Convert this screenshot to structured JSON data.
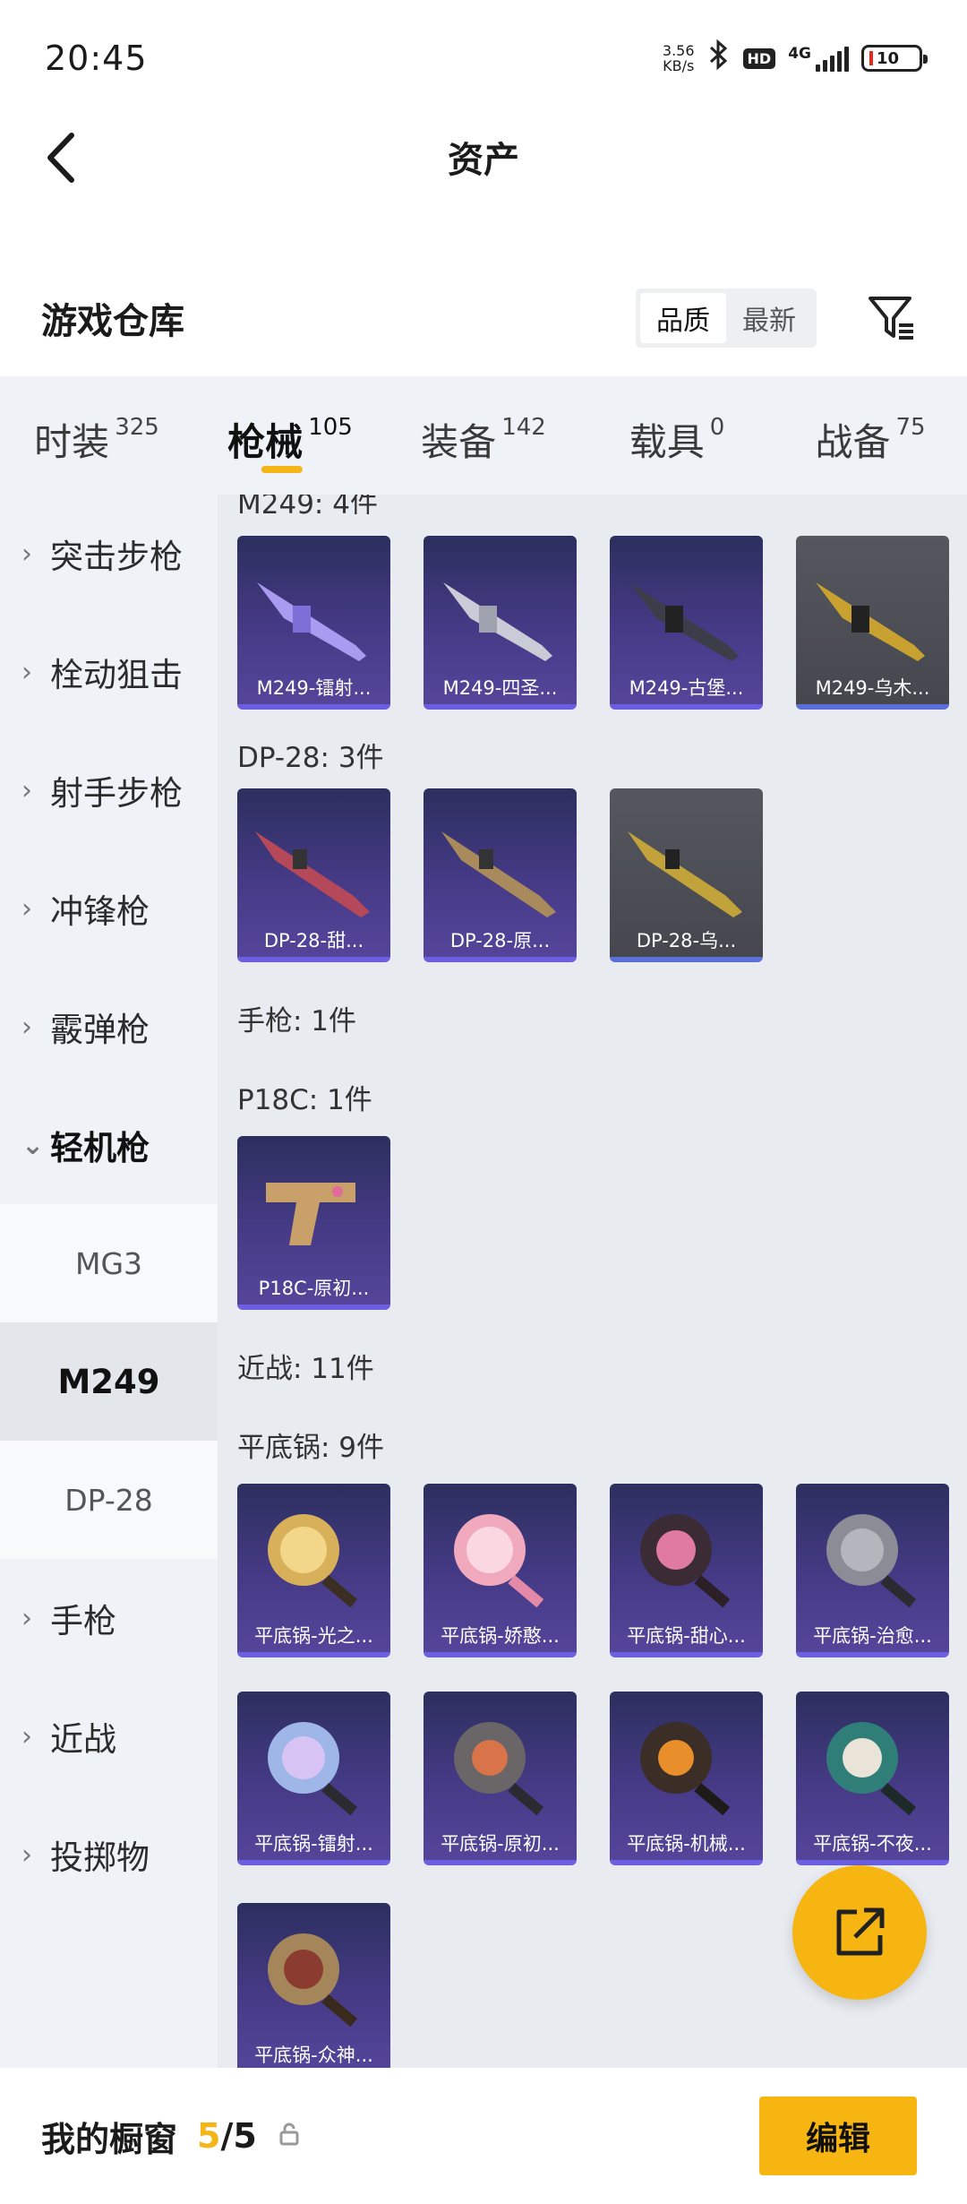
{
  "status_bar": {
    "time": "20:45",
    "net_speed_value": "3.56",
    "net_speed_unit": "KB/s",
    "hd": "HD",
    "network": "4G",
    "battery": "10"
  },
  "nav": {
    "title": "资产"
  },
  "warehouse": {
    "title": "游戏仓库",
    "sort_quality": "品质",
    "sort_newest": "最新"
  },
  "tabs": [
    {
      "label": "时装",
      "count": "325"
    },
    {
      "label": "枪械",
      "count": "105"
    },
    {
      "label": "装备",
      "count": "142"
    },
    {
      "label": "载具",
      "count": "0"
    },
    {
      "label": "战备",
      "count": "75"
    }
  ],
  "sidebar": {
    "items": [
      "突击步枪",
      "栓动狙击",
      "射手步枪",
      "冲锋枪",
      "霰弹枪",
      "轻机枪",
      "手枪",
      "近战",
      "投掷物"
    ],
    "sub_items": [
      "MG3",
      "M249",
      "DP-28"
    ]
  },
  "content": {
    "m249_title": "M249: 4件",
    "m249_items": [
      "M249-镭射...",
      "M249-四圣...",
      "M249-古堡...",
      "M249-乌木..."
    ],
    "dp28_title": "DP-28: 3件",
    "dp28_items": [
      "DP-28-甜...",
      "DP-28-原...",
      "DP-28-乌..."
    ],
    "pistol_title": "手枪: 1件",
    "p18c_title": "P18C: 1件",
    "p18c_items": [
      "P18C-原初..."
    ],
    "melee_title": "近战: 11件",
    "pan_title": "平底锅: 9件",
    "pan_items": [
      "平底锅-光之...",
      "平底锅-娇憨...",
      "平底锅-甜心...",
      "平底锅-治愈...",
      "平底锅-镭射...",
      "平底锅-原初...",
      "平底锅-机械...",
      "平底锅-不夜...",
      "平底锅-众神..."
    ]
  },
  "showcase": {
    "title": "我的橱窗",
    "current": "5",
    "separator_total": "/5",
    "edit_label": "编辑"
  },
  "colors": {
    "accent": "#f7b512",
    "panel_bg": "#eff3f8",
    "content_bg": "#e8ebf0",
    "card_purple": "#463a86"
  },
  "icons": [
    "back-arrow-icon",
    "filter-icon",
    "chevron-right-icon",
    "chevron-down-icon",
    "share-external-icon",
    "lock-icon",
    "bluetooth-icon"
  ]
}
